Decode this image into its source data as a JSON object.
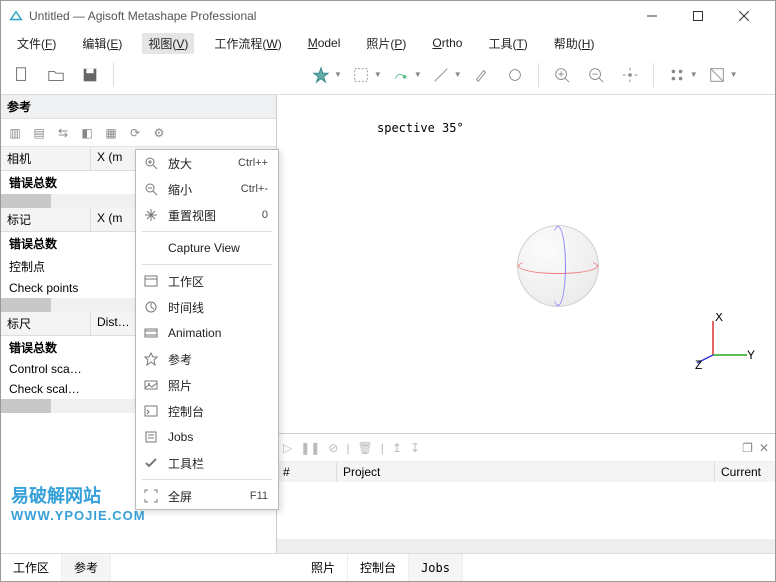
{
  "window": {
    "title": "Untitled — Agisoft Metashape Professional"
  },
  "menubar": {
    "items": [
      {
        "label": "文件",
        "accel": "F"
      },
      {
        "label": "编辑",
        "accel": "E"
      },
      {
        "label": "视图",
        "accel": "V"
      },
      {
        "label": "工作流程",
        "accel": "W"
      },
      {
        "label": "Model",
        "accel": "M",
        "latin": true
      },
      {
        "label": "照片",
        "accel": "P"
      },
      {
        "label": "Ortho",
        "accel": "O",
        "latin": true
      },
      {
        "label": "工具",
        "accel": "T"
      },
      {
        "label": "帮助",
        "accel": "H"
      }
    ],
    "active_index": 2
  },
  "dropdown": {
    "items": [
      {
        "icon": "zoom-in",
        "label": "放大",
        "shortcut": "Ctrl++"
      },
      {
        "icon": "zoom-out",
        "label": "缩小",
        "shortcut": "Ctrl+-"
      },
      {
        "icon": "move-reset",
        "label": "重置视图",
        "shortcut": "0"
      },
      {
        "sep": true
      },
      {
        "icon": "",
        "label": "Capture View",
        "shortcut": ""
      },
      {
        "sep": true
      },
      {
        "icon": "workspace",
        "label": "工作区",
        "shortcut": ""
      },
      {
        "icon": "timeline",
        "label": "时间线",
        "shortcut": ""
      },
      {
        "icon": "animation",
        "label": "Animation",
        "shortcut": ""
      },
      {
        "icon": "reference",
        "label": "参考",
        "shortcut": ""
      },
      {
        "icon": "photos",
        "label": "照片",
        "shortcut": ""
      },
      {
        "icon": "console",
        "label": "控制台",
        "shortcut": ""
      },
      {
        "icon": "jobs",
        "label": "Jobs",
        "shortcut": ""
      },
      {
        "icon": "check",
        "label": "工具栏",
        "shortcut": ""
      },
      {
        "sep": true
      },
      {
        "icon": "fullscreen",
        "label": "全屏",
        "shortcut": "F11"
      }
    ]
  },
  "reference_panel": {
    "title": "参考",
    "sections": [
      {
        "header_cols": [
          "相机",
          "X (m"
        ],
        "rows": [
          "错误总数"
        ]
      },
      {
        "header_cols": [
          "标记",
          "X (m"
        ],
        "rows": [
          "错误总数",
          "控制点",
          "Check points"
        ]
      },
      {
        "header_cols": [
          "标尺",
          "Dist…"
        ],
        "rows": [
          "错误总数",
          "Control sca…",
          "Check scal…"
        ]
      }
    ]
  },
  "viewport": {
    "label": "spective 35°",
    "axes": {
      "x": "X",
      "y": "Y",
      "z": "Z"
    }
  },
  "jobs": {
    "columns": [
      "#",
      "Project",
      "Current"
    ]
  },
  "footer_tabs": {
    "left": [
      "工作区",
      "参考"
    ],
    "left_active": 1,
    "right": [
      "照片",
      "控制台",
      "Jobs"
    ],
    "right_active": 2
  },
  "watermark": {
    "line1": "易破解网站",
    "line2": "WWW.YPOJIE.COM"
  }
}
